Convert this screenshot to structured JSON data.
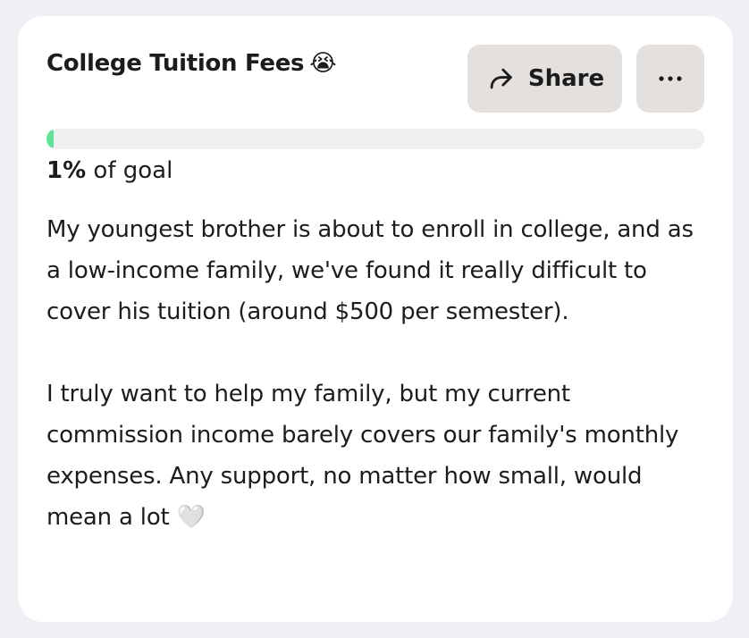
{
  "campaign": {
    "title": "College Tuition Fees",
    "title_emoji": "😭",
    "share_label": "Share",
    "more_icon": "more-horizontal-icon",
    "share_icon": "share-forward-icon",
    "progress": {
      "percent": 1,
      "percent_label": "1%",
      "suffix": " of goal",
      "fill_color": "#5fe39a"
    },
    "description": "My youngest brother is about to enroll in college, and as a low-income family, we've found it really difficult to cover his tuition (around $500 per semester).\n\nI truly want to help my family, but my current commission income barely covers our family's monthly expenses. Any support, no matter how small, would mean a lot 🤍"
  }
}
